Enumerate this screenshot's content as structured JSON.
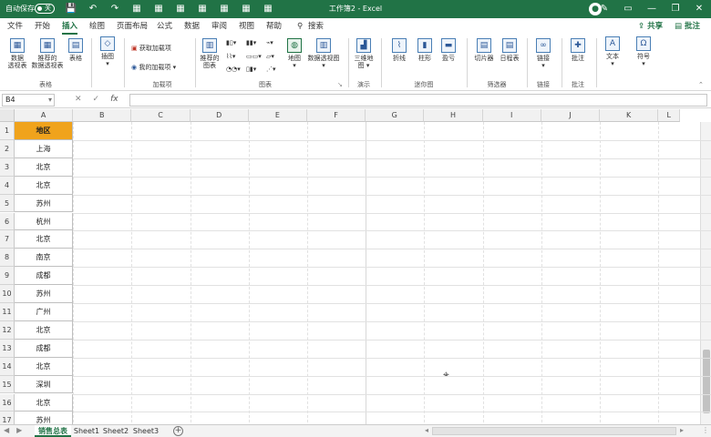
{
  "titlebar": {
    "autosave_label": "自动保存",
    "autosave_state": "关",
    "doc_title": "工作簿2  -  Excel",
    "qat_icons": [
      "save-icon",
      "undo-icon",
      "redo-icon",
      "grid-icon",
      "grid-icon",
      "grid-icon",
      "grid-icon",
      "grid-icon",
      "grid-icon",
      "grid-icon"
    ],
    "window_buttons": [
      "pen-icon",
      "ribbon-display-icon",
      "minimize-icon",
      "restore-icon",
      "close-icon"
    ]
  },
  "tabs": {
    "items": [
      "文件",
      "开始",
      "插入",
      "绘图",
      "页面布局",
      "公式",
      "数据",
      "审阅",
      "视图",
      "帮助"
    ],
    "active": "插入",
    "search": "搜索",
    "share": "共享",
    "comments": "批注"
  },
  "ribbon": {
    "groups": {
      "tables": "表格",
      "addins": "加载项",
      "charts": "图表",
      "tours": "演示",
      "sparklines": "迷你图",
      "filters": "筛选器",
      "links": "链接",
      "comments": "批注"
    },
    "buttons": {
      "pivot_table": "数据\n透视表",
      "recommended_pivot": "推荐的\n数据透视表",
      "table": "表格",
      "illustrations": "插图",
      "get_addins": "获取加载项",
      "my_addins": "我的加载项",
      "recommended_charts": "推荐的\n图表",
      "maps": "地图",
      "pivot_chart": "数据透视图",
      "map_3d": "三维地\n图",
      "line": "折线",
      "column": "柱形",
      "win_loss": "盈亏",
      "slicer": "切片器",
      "timeline": "日程表",
      "link": "链接",
      "comment": "批注",
      "text": "文本",
      "symbols": "符号"
    }
  },
  "formula_bar": {
    "name_box": "B4",
    "fx": "fx",
    "cancel": "✕",
    "enter": "✓",
    "value": ""
  },
  "grid": {
    "columns": [
      "A",
      "B",
      "C",
      "D",
      "E",
      "F",
      "G",
      "H",
      "I",
      "J",
      "K",
      "L"
    ],
    "rows": [
      "1",
      "2",
      "3",
      "4",
      "5",
      "6",
      "7",
      "8",
      "9",
      "10",
      "11",
      "12",
      "13",
      "14",
      "15",
      "16",
      "17"
    ],
    "col_a": [
      "地区",
      "上海",
      "北京",
      "北京",
      "苏州",
      "杭州",
      "北京",
      "南京",
      "成都",
      "苏州",
      "广州",
      "北京",
      "成都",
      "北京",
      "深圳",
      "北京",
      "苏州"
    ],
    "header_fill": "#F0A31C"
  },
  "sheets": {
    "tabs": [
      "销售总表",
      "Sheet1",
      "Sheet2",
      "Sheet3"
    ],
    "active": "销售总表",
    "add": "+"
  }
}
